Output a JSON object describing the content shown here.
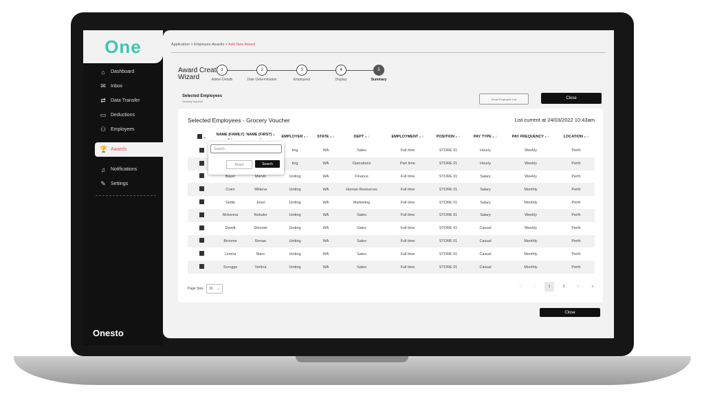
{
  "app": {
    "logo": "One",
    "brand": "Onesto"
  },
  "sidebar": {
    "items": [
      {
        "label": "Dashboard",
        "icon": "home-icon",
        "glyph": "⌂"
      },
      {
        "label": "Inbox",
        "icon": "inbox-icon",
        "glyph": "✉"
      },
      {
        "label": "Data Transfer",
        "icon": "transfer-icon",
        "glyph": "⇄"
      },
      {
        "label": "Deductions",
        "icon": "deductions-icon",
        "glyph": "▭"
      },
      {
        "label": "Employees",
        "icon": "employees-icon",
        "glyph": "⚇"
      },
      {
        "label": "Awards",
        "icon": "awards-icon",
        "glyph": "🏆"
      },
      {
        "label": "Notifications",
        "icon": "bell-icon",
        "glyph": "♫"
      },
      {
        "label": "Settings",
        "icon": "settings-icon",
        "glyph": "✎"
      }
    ]
  },
  "breadcrumb": {
    "path": "Application > Employee Awards > ",
    "current": "Add New Award"
  },
  "wizard": {
    "title_line1": "Award Creation",
    "title_line2": "Wizard",
    "steps": [
      {
        "num": "1",
        "label": "Admin Details"
      },
      {
        "num": "2",
        "label": "Date Determination"
      },
      {
        "num": "3",
        "label": "Employees"
      },
      {
        "num": "4",
        "label": "Display"
      },
      {
        "num": "5",
        "label": "Summary"
      }
    ]
  },
  "selected": {
    "title": "Selected Employees",
    "subtitle": "Grocery Voucher"
  },
  "buttons": {
    "email": "Email Employee List",
    "close": "Close",
    "close_bottom": "Close",
    "reset": "Reset",
    "search": "Search"
  },
  "card": {
    "title": "Selected Employees - Grocery Voucher",
    "list_current": "List current at 24/03/2022 10:43am"
  },
  "search_popup": {
    "placeholder": "Search"
  },
  "table": {
    "headers": [
      "NAME (FAMILY)",
      "NAME (FIRST)",
      "EMPLOYER",
      "STATE",
      "DEPT",
      "EMPLOYMENT",
      "POSITION",
      "PAY TYPE",
      "PAY FREQUENCY",
      "LOCATION"
    ],
    "rows": [
      [
        "",
        "",
        "ting",
        "WA",
        "Sales",
        "Full time",
        "STORE 01",
        "Hourly",
        "Weekly",
        "Perth"
      ],
      [
        "",
        "",
        "ting",
        "WA",
        "Operations",
        "Part time",
        "STORE 01",
        "Hourly",
        "Weekly",
        "Perth"
      ],
      [
        "Bayer",
        "Marvin",
        "Uniting",
        "WA",
        "Finance",
        "Full time",
        "STORE 01",
        "Salary",
        "Weekly",
        "Perth"
      ],
      [
        "Crain",
        "Willena",
        "Uniting",
        "WA",
        "Human Resources",
        "Full time",
        "STORE 01",
        "Salary",
        "Monthly",
        "Perth"
      ],
      [
        "Settle",
        "Jonel",
        "Uniting",
        "WA",
        "Marketing",
        "Full time",
        "STORE 01",
        "Salary",
        "Monthly",
        "Perth"
      ],
      [
        "Mckenna",
        "Nobuko",
        "Uniting",
        "WA",
        "Sales",
        "Full time",
        "STORE 01",
        "Salary",
        "Weekly",
        "Perth"
      ],
      [
        "Dewitt",
        "Dinorah",
        "Uniting",
        "WA",
        "Sales",
        "Full time",
        "STORE 01",
        "Casual",
        "Weekly",
        "Perth"
      ],
      [
        "Broome",
        "Renae",
        "Uniting",
        "WA",
        "Sales",
        "Full time",
        "STORE 01",
        "Casual",
        "Monthly",
        "Perth"
      ],
      [
        "Lemna",
        "Marx",
        "Uniting",
        "WA",
        "Sales",
        "Full time",
        "STORE 01",
        "Casual",
        "Monthly",
        "Perth"
      ],
      [
        "Scruggs",
        "Verlina",
        "Uniting",
        "WA",
        "Sales",
        "Full time",
        "STORE 01",
        "Casual",
        "Monthly",
        "Perth"
      ]
    ]
  },
  "pagination": {
    "page_size_label": "Page Size",
    "page_size": "10",
    "pages": [
      "1",
      "2"
    ],
    "first": "«",
    "prev": "‹",
    "next": "›",
    "last": "»"
  }
}
